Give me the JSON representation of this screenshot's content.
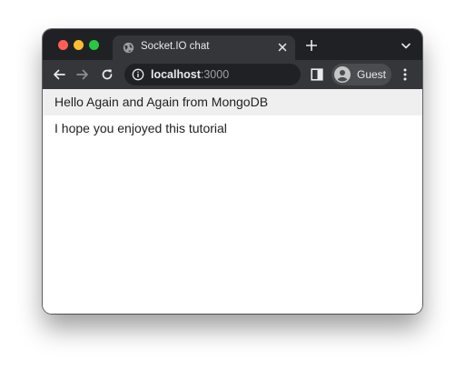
{
  "tab": {
    "title": "Socket.IO chat",
    "favicon": "globe-icon"
  },
  "address_bar": {
    "host": "localhost",
    "port": ":3000"
  },
  "profile": {
    "label": "Guest"
  },
  "messages": [
    {
      "text": "Hello Again and Again from MongoDB"
    },
    {
      "text": "I hope you enjoyed this tutorial"
    }
  ],
  "colors": {
    "tabstrip": "#202124",
    "toolbar": "#35363a",
    "message_stripe": "#efefef",
    "traffic_red": "#ff5f57",
    "traffic_yellow": "#febc2e",
    "traffic_green": "#28c840"
  }
}
